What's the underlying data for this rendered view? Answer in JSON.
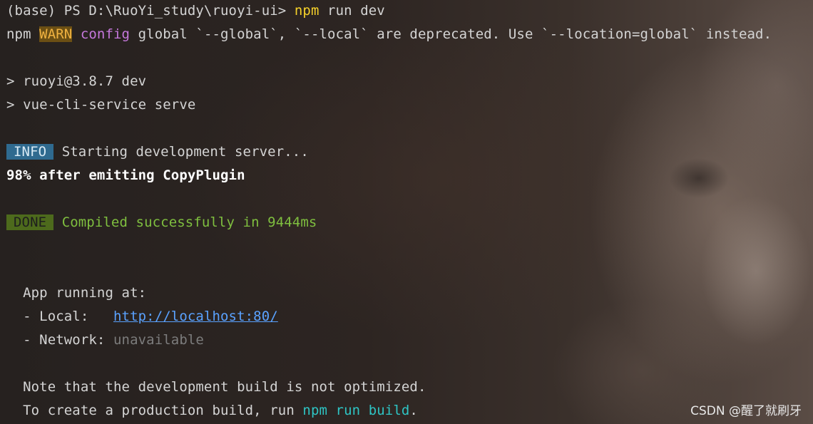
{
  "terminal": {
    "prompt": "(base) PS D:\\RuoYi_study\\ruoyi-ui> ",
    "command_npm": "npm",
    "command_rest": " run dev",
    "warn_prefix": "npm ",
    "warn_badge": "WARN",
    "warn_config": " config",
    "warn_text": " global `--global`, `--local` are deprecated. Use `--location=global` instead.",
    "script_line1": "> ruoyi@3.8.7 dev",
    "script_line2": "> vue-cli-service serve",
    "info_badge": "INFO",
    "info_text": " Starting development server...",
    "progress_text": "98% after emitting CopyPlugin",
    "done_badge": "DONE",
    "done_text": " Compiled successfully in 9444ms",
    "app_running": "  App running at:",
    "local_label": "  - Local:   ",
    "local_url": "http://localhost:80/",
    "network_label": "  - Network: ",
    "network_value": "unavailable",
    "note_line": "  Note that the development build is not optimized.",
    "build_prefix": "  To create a production build, run ",
    "build_command": "npm run build",
    "build_suffix": "."
  },
  "watermark": "CSDN @醒了就刷牙",
  "colors": {
    "warn_badge_bg": "#6b4f14",
    "info_badge_bg": "#2f6a8f",
    "done_badge_bg": "#4d6a1c",
    "success_text": "#7fbf3f",
    "link": "#5aa2ff",
    "command": "#f5d02a"
  }
}
